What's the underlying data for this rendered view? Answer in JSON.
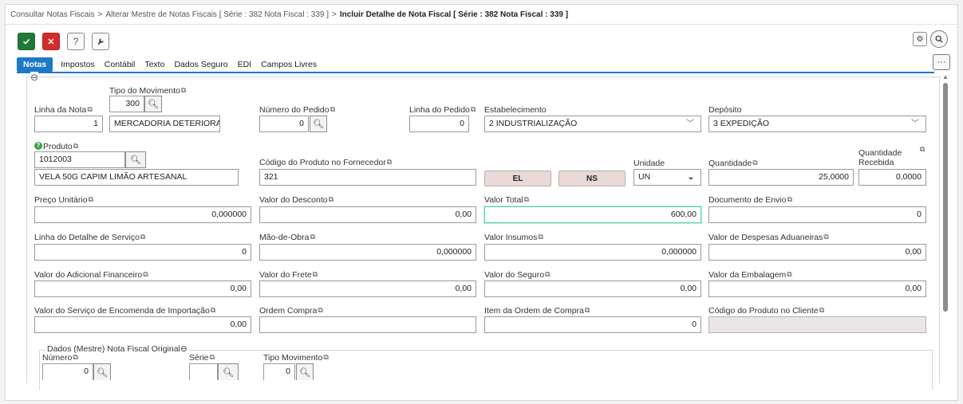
{
  "breadcrumb": {
    "items": [
      "Consultar Notas Fiscais",
      "Alterar Mestre de Notas Fiscais [ Série : 382 Nota Fiscal : 339 ]",
      "Incluir Detalhe de Nota Fiscal [ Série : 382 Nota Fiscal : 339 ]"
    ],
    "separator": ">"
  },
  "toolbar": {
    "confirm_icon": "check-icon",
    "cancel_icon": "close-icon",
    "help_label": "?",
    "tools_icon": "wrench-icon",
    "settings_icon": "gear-icon",
    "search_icon": "search-icon",
    "more_label": "···"
  },
  "tabs": [
    "Notas",
    "Impostos",
    "Contábil",
    "Texto",
    "Dados Seguro",
    "EDI",
    "Campos Livres"
  ],
  "active_tab": "Notas",
  "form": {
    "collapse_symbol": "⊖",
    "tipo_movimento": {
      "label": "Tipo do Movimento",
      "code": "300",
      "description": "MERCADORIA DETERIORADA"
    },
    "linha_nota": {
      "label": "Linha da Nota",
      "value": "1"
    },
    "numero_pedido": {
      "label": "Número do Pedido",
      "value": "0"
    },
    "linha_pedido": {
      "label": "Linha do Pedido",
      "value": "0"
    },
    "estabelecimento": {
      "label": "Estabelecimento",
      "value": "2 INDUSTRIALIZAÇÃO"
    },
    "deposito": {
      "label": "Depósito",
      "value": "3 EXPEDIÇÃO"
    },
    "produto": {
      "label": "Produto",
      "code": "1012003",
      "description": "VELA 50G CAPIM LIMÃO ARTESANAL"
    },
    "codigo_fornecedor": {
      "label": "Código do Produto no Fornecedor",
      "value": "321"
    },
    "btn_el": "EL",
    "btn_ns": "NS",
    "unidade": {
      "label": "Unidade",
      "value": "UN"
    },
    "quantidade": {
      "label": "Quantidade",
      "value": "25,0000"
    },
    "quantidade_recebida": {
      "label_line1": "Quantidade",
      "label_line2": "Recebida",
      "value": "0,0000"
    },
    "preco_unitario": {
      "label": "Preço Unitário",
      "value": "0,000000"
    },
    "valor_desconto": {
      "label": "Valor do Desconto",
      "value": "0,00"
    },
    "valor_total": {
      "label": "Valor Total",
      "value": "600,00"
    },
    "documento_envio": {
      "label": "Documento de Envio",
      "value": "0"
    },
    "linha_detalhe_servico": {
      "label": "Linha do Detalhe de Serviço",
      "value": "0"
    },
    "mao_de_obra": {
      "label": "Mão-de-Obra",
      "value": "0,000000"
    },
    "valor_insumos": {
      "label": "Valor Insumos",
      "value": "0,000000"
    },
    "valor_despesas_aduaneiras": {
      "label": "Valor de Despesas Aduaneiras",
      "value": "0,00"
    },
    "valor_adicional_financeiro": {
      "label": "Valor do Adicional Financeiro",
      "value": "0,00"
    },
    "valor_frete": {
      "label": "Valor do Frete",
      "value": "0,00"
    },
    "valor_seguro": {
      "label": "Valor do Seguro",
      "value": "0,00"
    },
    "valor_embalagem": {
      "label": "Valor da Embalagem",
      "value": "0,00"
    },
    "valor_servico_encomenda": {
      "label": "Valor do Serviço de Encomenda de Importação",
      "value": "0,00"
    },
    "ordem_compra": {
      "label": "Ordem Compra",
      "value": ""
    },
    "item_ordem_compra": {
      "label": "Item da Ordem de Compra",
      "value": "0"
    },
    "codigo_produto_cliente": {
      "label": "Código do Produto no Cliente",
      "value": ""
    }
  },
  "mestre_original": {
    "legend": "Dados (Mestre) Nota Fiscal Original",
    "numero": {
      "label": "Número",
      "value": "0"
    },
    "serie": {
      "label": "Série",
      "value": ""
    },
    "tipo_movimento": {
      "label": "Tipo Movimento",
      "value": "0"
    }
  },
  "colors": {
    "accent": "#1e78c8",
    "confirm": "#1f7a38",
    "cancel": "#d42b2b",
    "focus": "#4fd1a5"
  }
}
